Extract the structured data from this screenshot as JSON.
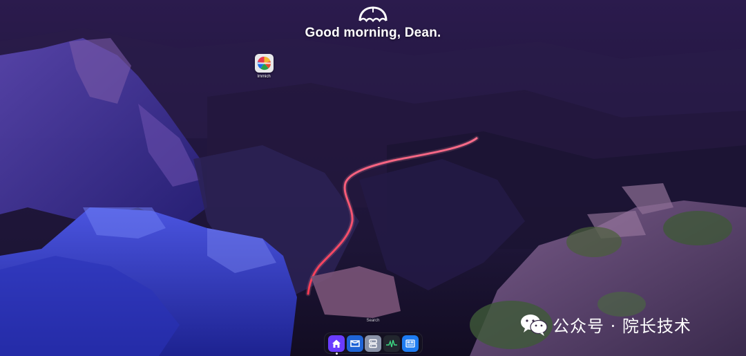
{
  "greeting": {
    "title": "Good morning, Dean.",
    "icon": "umbrella-icon"
  },
  "desktop_apps": [
    {
      "label": "Immich",
      "icon": "immich-pinwheel-icon"
    }
  ],
  "search": {
    "label": "Search"
  },
  "dock": {
    "items": [
      {
        "icon": "home-icon",
        "color": "#6a3cff",
        "active": true
      },
      {
        "icon": "inbox-icon",
        "color": "#1f64d6",
        "active": false
      },
      {
        "icon": "server-icon",
        "color": "#8a93a8",
        "active": false
      },
      {
        "icon": "activity-monitor-icon",
        "color": "#22262e",
        "active": false
      },
      {
        "icon": "dashboard-icon",
        "color": "#1e7cf2",
        "active": false
      }
    ]
  },
  "watermark": {
    "text": "公众号 · 院长技术",
    "icon": "wechat-icon"
  },
  "colors": {
    "sky": "#2d1c55",
    "road_light": "#ff3b5c",
    "rock": "#4a4fd8"
  }
}
